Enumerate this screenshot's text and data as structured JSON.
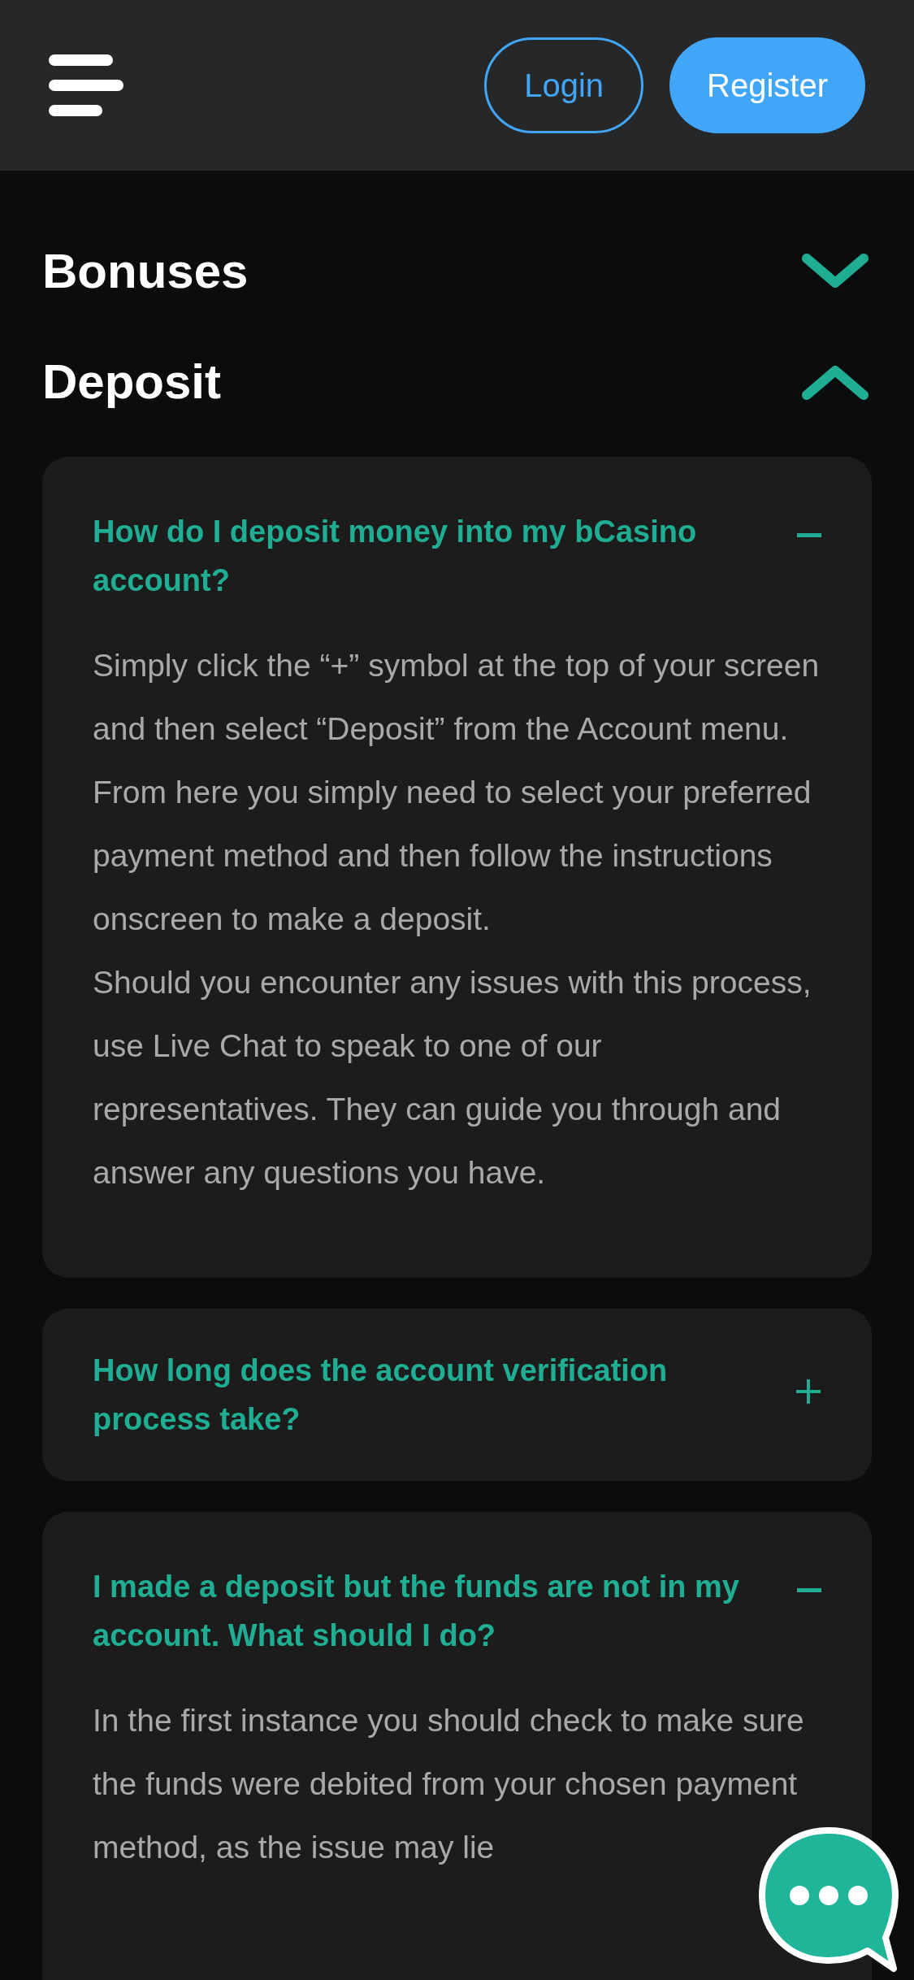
{
  "header": {
    "buttons": [
      {
        "label": "Login",
        "kind": "outline"
      },
      {
        "label": "Register",
        "kind": "filled"
      }
    ]
  },
  "sections": [
    {
      "title": "Bonuses",
      "expanded": false
    },
    {
      "title": "Deposit",
      "expanded": true,
      "questions": [
        {
          "question": "How do I deposit money into my bCasino account?",
          "expanded": true,
          "answer": [
            "Simply click the “+” symbol at the top of your screen and then select “Deposit” from the Account menu. From here you simply need to select your preferred payment method and then follow the instructions onscreen to make a deposit.",
            "Should you encounter any issues with this process, use Live Chat to speak to one of our representatives. They can guide you through and answer any questions you have."
          ]
        },
        {
          "question": "How long does the account verification process take?",
          "expanded": false
        },
        {
          "question": "I made a deposit but the funds are not in my account. What should I do?",
          "expanded": true,
          "answer": [
            "In the first instance you should check to make sure the funds were debited from your chosen payment method, as the issue may lie"
          ]
        }
      ]
    }
  ]
}
